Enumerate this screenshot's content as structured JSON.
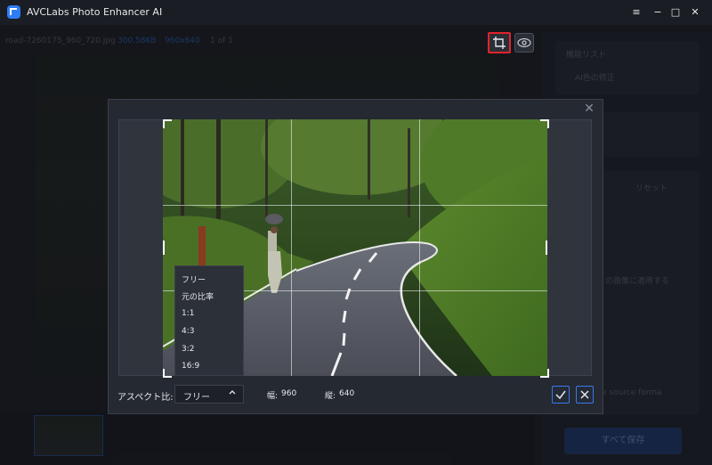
{
  "window": {
    "title": "AVCLabs Photo Enhancer AI",
    "controls": {
      "menu": "≡",
      "minimize": "−",
      "maximize": "□",
      "close": "✕"
    }
  },
  "infobar": {
    "filename": "road-7260175_960_720.jpg",
    "filesize": "300.58KB",
    "resolution": "960x640",
    "page": "1 of 1"
  },
  "right_panel": {
    "feature_list_label": "機能リスト",
    "feature_selected": "AI色の修正",
    "reset_label": "リセット",
    "apply_all_label": "の画像に適用する",
    "format_label": "e source forma",
    "save_all_label": "すべて保存"
  },
  "crop_dialog": {
    "aspect_label": "アスペクト比:",
    "aspect_selected": "フリー",
    "aspect_options": [
      "フリー",
      "元の比率",
      "1:1",
      "4:3",
      "3:2",
      "16:9"
    ],
    "width_label": "幅:",
    "width_value": "960",
    "height_label": "縦:",
    "height_value": "640",
    "close_glyph": "✕",
    "confirm_glyph": "✓",
    "cancel_glyph": "✕"
  },
  "icons": {
    "app_logo": "app-logo-icon",
    "crop": "crop-icon",
    "eye": "eye-icon"
  },
  "colors": {
    "accent": "#2f7df6",
    "highlight_border": "#e0242a"
  }
}
